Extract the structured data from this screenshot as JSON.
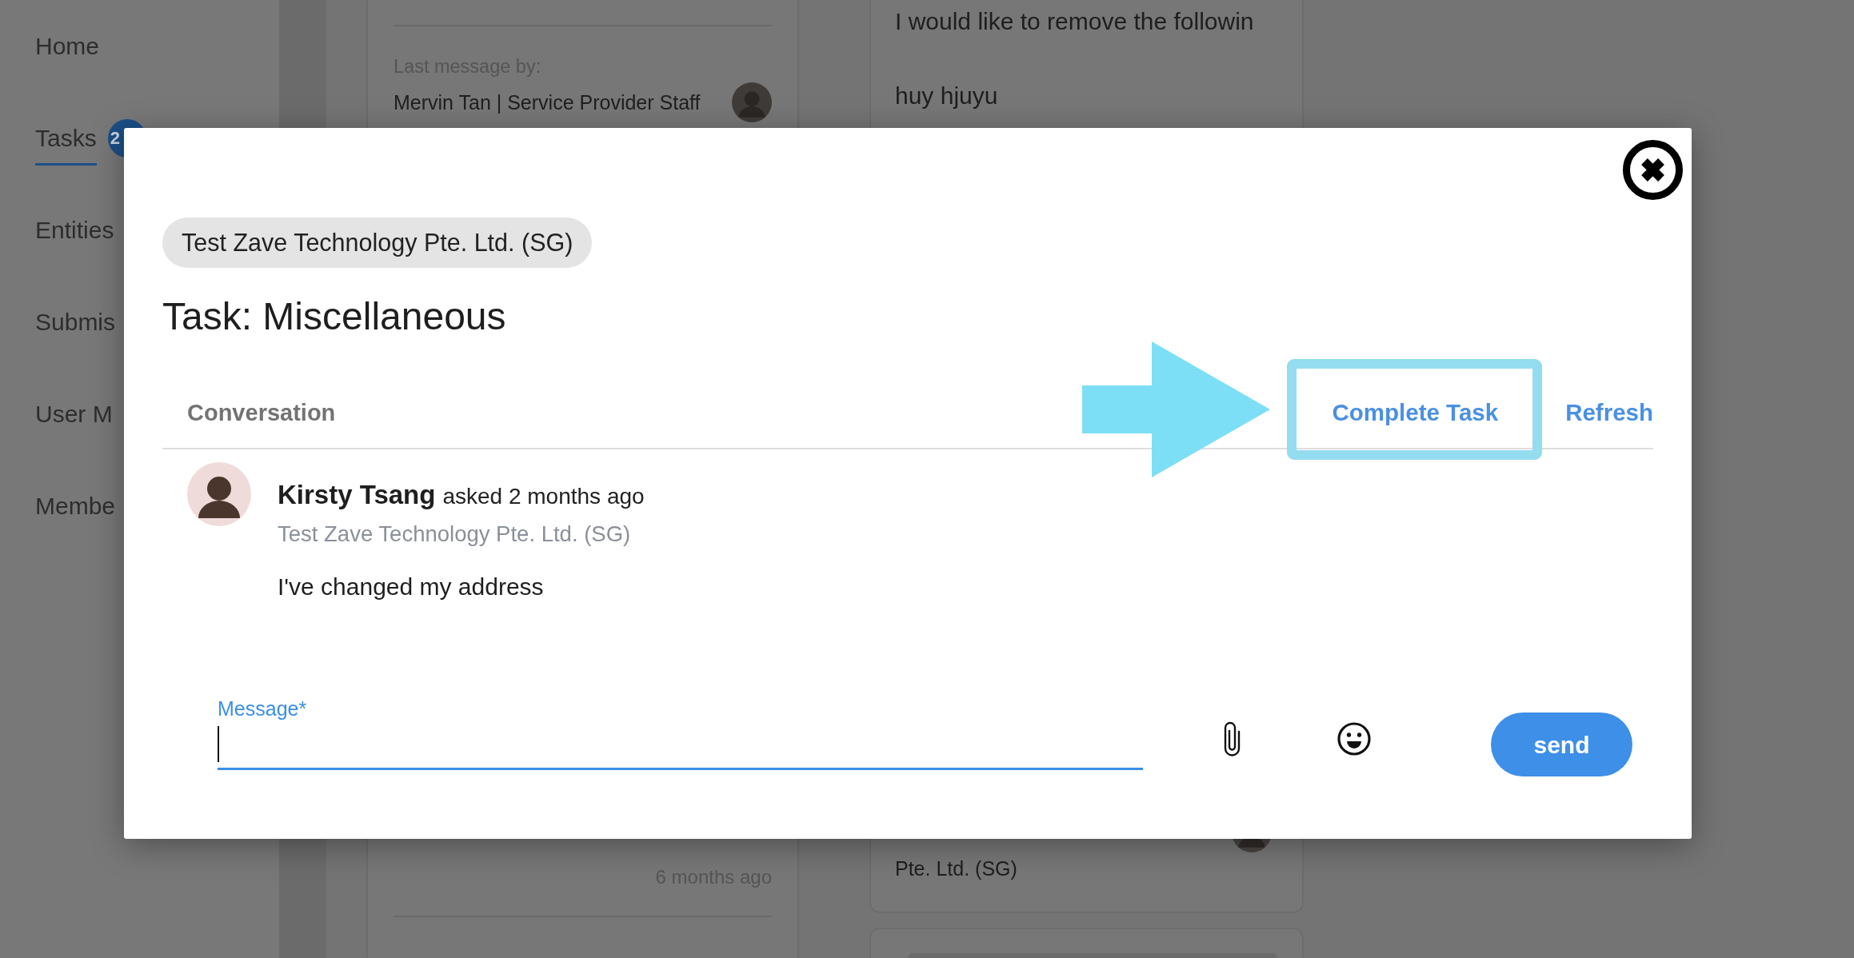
{
  "sidebar": {
    "items": [
      {
        "label": "Home",
        "selected": false
      },
      {
        "label": "Tasks",
        "selected": true,
        "badge": "2"
      },
      {
        "label": "Entities",
        "selected": false
      },
      {
        "label": "Submis",
        "selected": false
      },
      {
        "label": "User M",
        "selected": false
      },
      {
        "label": "Membe",
        "selected": false
      }
    ]
  },
  "task_list": {
    "left_card": {
      "last_message_label": "Last message by:",
      "last_message_author": "Mervin Tan | Service Provider Staff",
      "time": "6 months ago"
    },
    "right_card": {
      "lines": [
        "I would like to remove the followin",
        "huy hjuyu"
      ],
      "footer": "Pte. Ltd. (SG)"
    }
  },
  "dialog": {
    "entity": "Test Zave Technology Pte. Ltd. (SG)",
    "title": "Task: Miscellaneous",
    "section": "Conversation",
    "actions": [
      {
        "label": "Complete Task",
        "highlighted": true
      },
      {
        "label": "Refresh",
        "highlighted": false
      }
    ],
    "messages": [
      {
        "author": "Kirsty Tsang",
        "action": "asked 2 months ago",
        "organization": "Test Zave Technology Pte. Ltd. (SG)",
        "body": "I've changed my address"
      }
    ],
    "composer": {
      "label": "Message*",
      "focused": true,
      "send_label": "send"
    }
  }
}
